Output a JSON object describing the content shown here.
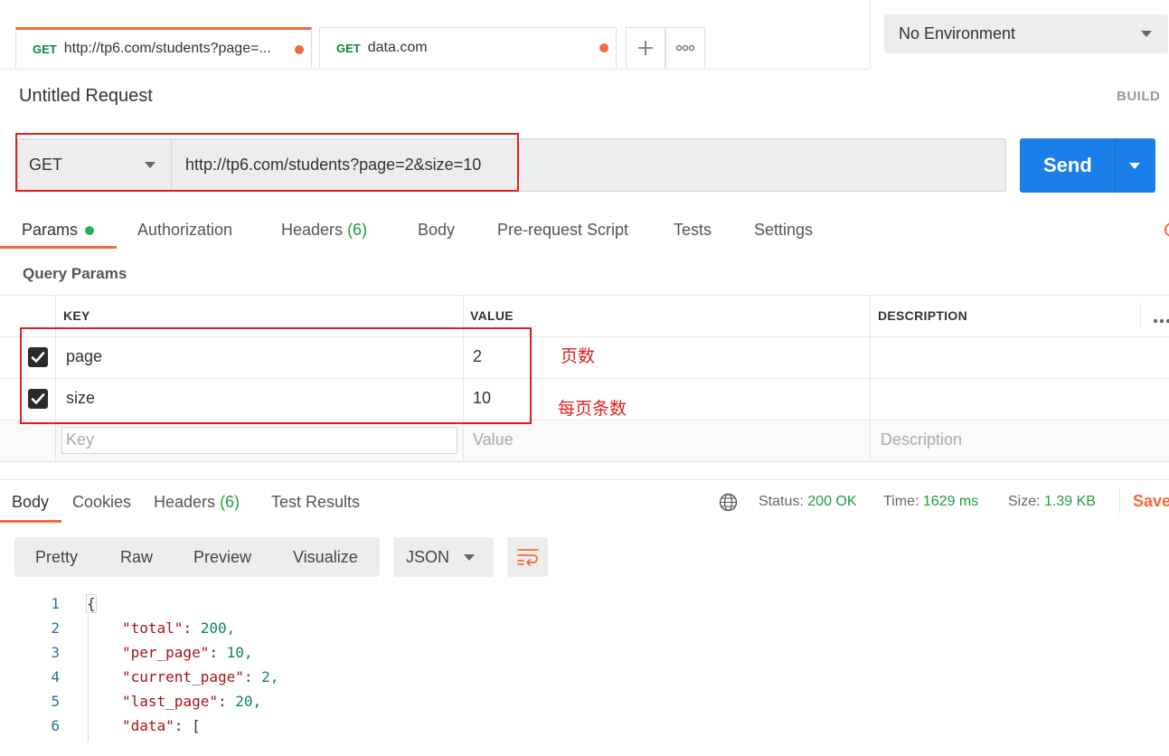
{
  "tabs": [
    {
      "method": "GET",
      "title": "http://tp6.com/students?page=...",
      "active": true
    },
    {
      "method": "GET",
      "title": "data.com",
      "active": false
    }
  ],
  "tab_actions": {
    "add": "+",
    "more": "ooo"
  },
  "environment": {
    "selected": "No Environment"
  },
  "request": {
    "name": "Untitled Request",
    "build_label": "BUILD",
    "method": "GET",
    "url": "http://tp6.com/students?page=2&size=10",
    "send_label": "Send"
  },
  "request_tabs": {
    "params": "Params",
    "authorization": "Authorization",
    "headers": "Headers",
    "headers_count": "(6)",
    "body": "Body",
    "prerequest": "Pre-request Script",
    "tests": "Tests",
    "settings": "Settings"
  },
  "query_params": {
    "title": "Query Params",
    "columns": {
      "key": "KEY",
      "value": "VALUE",
      "description": "DESCRIPTION"
    },
    "rows": [
      {
        "key": "page",
        "value": "2",
        "checked": true
      },
      {
        "key": "size",
        "value": "10",
        "checked": true
      }
    ],
    "placeholders": {
      "key": "Key",
      "value": "Value",
      "description": "Description"
    }
  },
  "annotations": {
    "page": "页数",
    "size": "每页条数"
  },
  "response_tabs": {
    "body": "Body",
    "cookies": "Cookies",
    "headers": "Headers",
    "headers_count": "(6)",
    "test_results": "Test Results"
  },
  "response_status": {
    "status_label": "Status:",
    "status_value": "200 OK",
    "time_label": "Time:",
    "time_value": "1629 ms",
    "size_label": "Size:",
    "size_value": "1.39 KB",
    "save_label": "Save"
  },
  "view_options": {
    "pretty": "Pretty",
    "raw": "Raw",
    "preview": "Preview",
    "visualize": "Visualize",
    "format": "JSON"
  },
  "code_lines": [
    {
      "n": "1",
      "text": "{"
    },
    {
      "n": "2",
      "key": "\"total\"",
      "val": "200,"
    },
    {
      "n": "3",
      "key": "\"per_page\"",
      "val": "10,"
    },
    {
      "n": "4",
      "key": "\"current_page\"",
      "val": "2,"
    },
    {
      "n": "5",
      "key": "\"last_page\"",
      "val": "20,"
    },
    {
      "n": "6",
      "key": "\"data\"",
      "val": "["
    }
  ],
  "colors": {
    "accent": "#f26b3a",
    "send": "#1a7fe8",
    "success": "#1e9e3c",
    "annotation": "#e02020"
  }
}
